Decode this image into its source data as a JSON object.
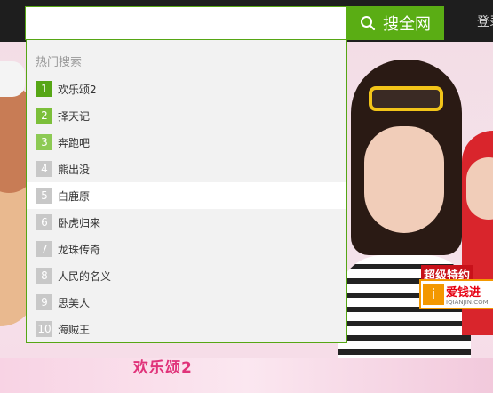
{
  "header": {
    "login_label": "登录"
  },
  "search": {
    "value": "",
    "placeholder": "",
    "button_label": "搜全网"
  },
  "dropdown": {
    "heading": "热门搜索",
    "items": [
      {
        "rank": "1",
        "label": "欢乐颂2"
      },
      {
        "rank": "2",
        "label": "择天记"
      },
      {
        "rank": "3",
        "label": "奔跑吧"
      },
      {
        "rank": "4",
        "label": "熊出没"
      },
      {
        "rank": "5",
        "label": "白鹿原"
      },
      {
        "rank": "6",
        "label": "卧虎归来"
      },
      {
        "rank": "7",
        "label": "龙珠传奇"
      },
      {
        "rank": "8",
        "label": "人民的名义"
      },
      {
        "rank": "9",
        "label": "思美人"
      },
      {
        "rank": "10",
        "label": "海贼王"
      }
    ],
    "active_index": 4
  },
  "banner": {
    "show_title": "欢乐颂2",
    "promo_label": "超级特约",
    "promo_brand": "爱钱进",
    "promo_domain": "IQIANJIN.COM"
  },
  "colors": {
    "accent": "#5aad14",
    "topbar": "#1e1e1e"
  }
}
